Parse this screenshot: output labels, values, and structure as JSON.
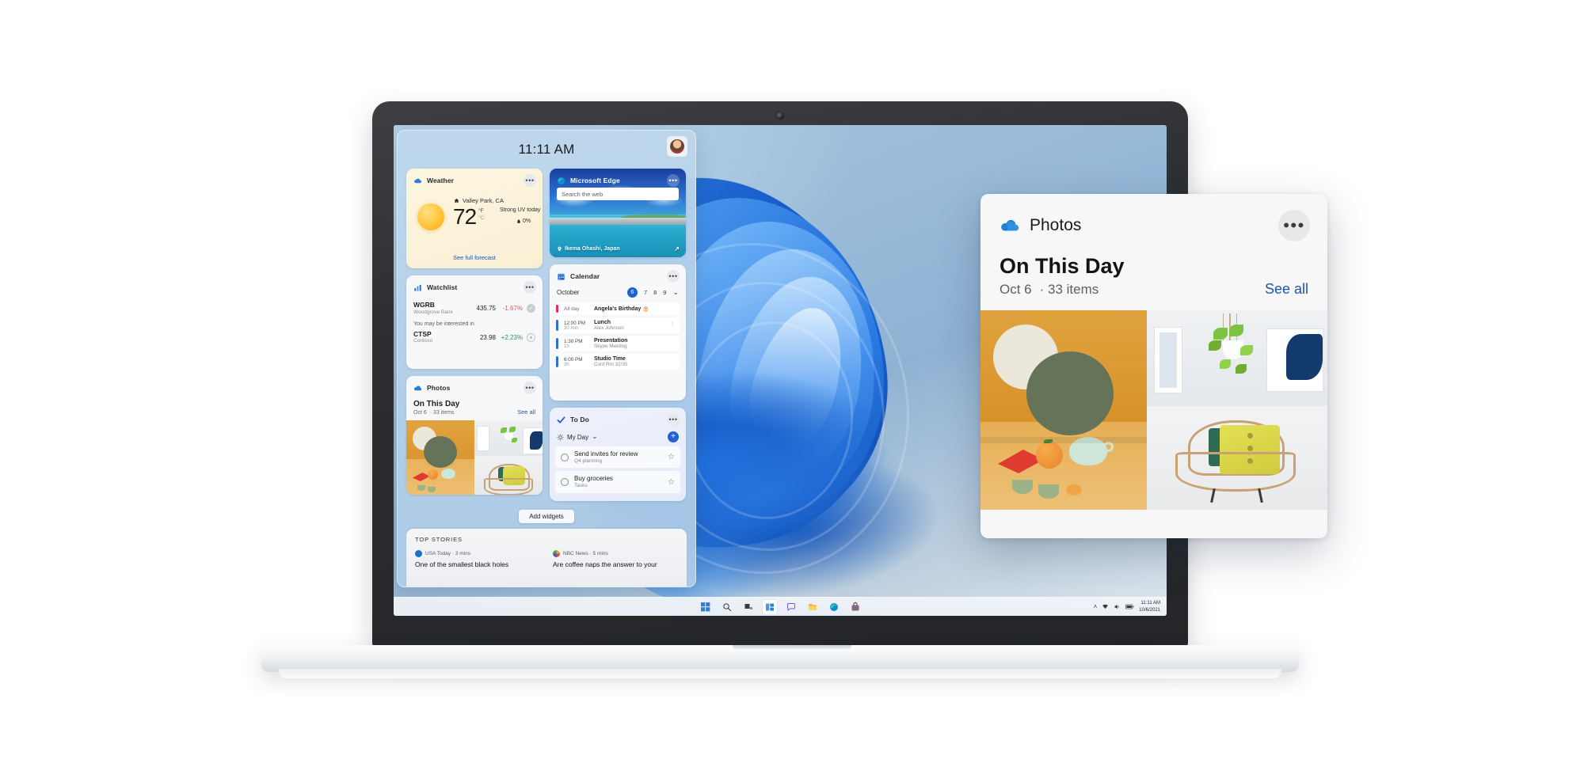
{
  "widgets_panel": {
    "clock": "11:11 AM",
    "avatar_name": "user-avatar",
    "add_widgets_label": "Add widgets",
    "weather": {
      "app": "Weather",
      "icon": "weather-cloud-icon",
      "location": "Valley Park, CA",
      "temperature": "72",
      "unit_primary": "°F",
      "unit_secondary": "°C",
      "uv": "Strong UV today",
      "precipitation": "0%",
      "link": "See full forecast",
      "more": "•••"
    },
    "edge": {
      "app": "Microsoft Edge",
      "icon": "edge-icon",
      "search_placeholder": "Search the web",
      "photo_location": "Ikema Ohashi, Japan",
      "more": "•••"
    },
    "watchlist": {
      "app": "Watchlist",
      "icon": "chart-bars-icon",
      "more": "•••",
      "note": "You may be interested in",
      "rows": [
        {
          "symbol": "WGRB",
          "company": "Woodgrove Bank",
          "price": "435.75",
          "change": "-1.67%",
          "direction": "down",
          "action": "check"
        },
        {
          "symbol": "CTSP",
          "company": "Contoso",
          "price": "23.98",
          "change": "+2.23%",
          "direction": "up",
          "action": "plus"
        }
      ]
    },
    "calendar": {
      "app": "Calendar",
      "icon": "calendar-icon",
      "more": "•••",
      "month": "October",
      "days": [
        "6",
        "7",
        "8",
        "9"
      ],
      "selected_day": "6",
      "chevron": "⌄",
      "events": [
        {
          "time": "All day",
          "duration": "",
          "title": "Angela's Birthday 🎂",
          "sub": "",
          "color": "#e8286f"
        },
        {
          "time": "12:00 PM",
          "duration": "30 min",
          "title": "Lunch",
          "sub": "Alex Johnson",
          "color": "#2f6fd0"
        },
        {
          "time": "1:30 PM",
          "duration": "1h",
          "title": "Presentation",
          "sub": "Skype Meeting",
          "color": "#2f6fd0"
        },
        {
          "time": "6:00 PM",
          "duration": "3h",
          "title": "Studio Time",
          "sub": "Conf Rm 32/35",
          "color": "#2f6fd0"
        }
      ]
    },
    "photos": {
      "app": "Photos",
      "icon": "onedrive-cloud-icon",
      "more": "•••",
      "title": "On This Day",
      "date": "Oct 6",
      "count": "·  33 items",
      "see_all": "See all"
    },
    "todo": {
      "app": "To Do",
      "icon": "checkmark-icon",
      "more": "•••",
      "list_name": "My Day",
      "list_icon": "sun-icon",
      "chevron": "⌄",
      "add_label": "+",
      "items": [
        {
          "title": "Send invites for review",
          "sub": "Q4 planning",
          "star": "☆"
        },
        {
          "title": "Buy groceries",
          "sub": "Tasks",
          "star": "☆"
        }
      ]
    },
    "news": {
      "heading": "TOP STORIES",
      "items": [
        {
          "source": "USA Today · 3 mins",
          "headline": "One of the smallest black holes",
          "color": "#1c6fc7"
        },
        {
          "source": "NBC News · 5 mins",
          "headline": "Are coffee naps the answer to your",
          "color": "#e2a63a"
        }
      ]
    }
  },
  "photos_card": {
    "app": "Photos",
    "icon": "onedrive-cloud-icon",
    "more": "•••",
    "title": "On This Day",
    "date": "Oct 6",
    "count": "·  33 items",
    "see_all": "See all"
  },
  "taskbar": {
    "items": [
      {
        "name": "start-button",
        "label": "Start"
      },
      {
        "name": "search-button",
        "label": "Search"
      },
      {
        "name": "task-view-button",
        "label": "Task View"
      },
      {
        "name": "widgets-button",
        "label": "Widgets"
      },
      {
        "name": "chat-button",
        "label": "Chat"
      },
      {
        "name": "file-explorer-button",
        "label": "File Explorer"
      },
      {
        "name": "edge-button",
        "label": "Microsoft Edge"
      },
      {
        "name": "microsoft-store-button",
        "label": "Microsoft Store"
      }
    ],
    "tray": {
      "chevron": "˄",
      "wifi": "wifi-icon",
      "volume": "volume-icon",
      "battery": "battery-icon",
      "time": "11:11 AM",
      "date": "10/6/2021"
    }
  },
  "colors": {
    "accent": "#1f62d2",
    "link": "#1a56b0",
    "up": "#1a9e54",
    "down": "#e05a4f",
    "birthday": "#e8286f"
  }
}
